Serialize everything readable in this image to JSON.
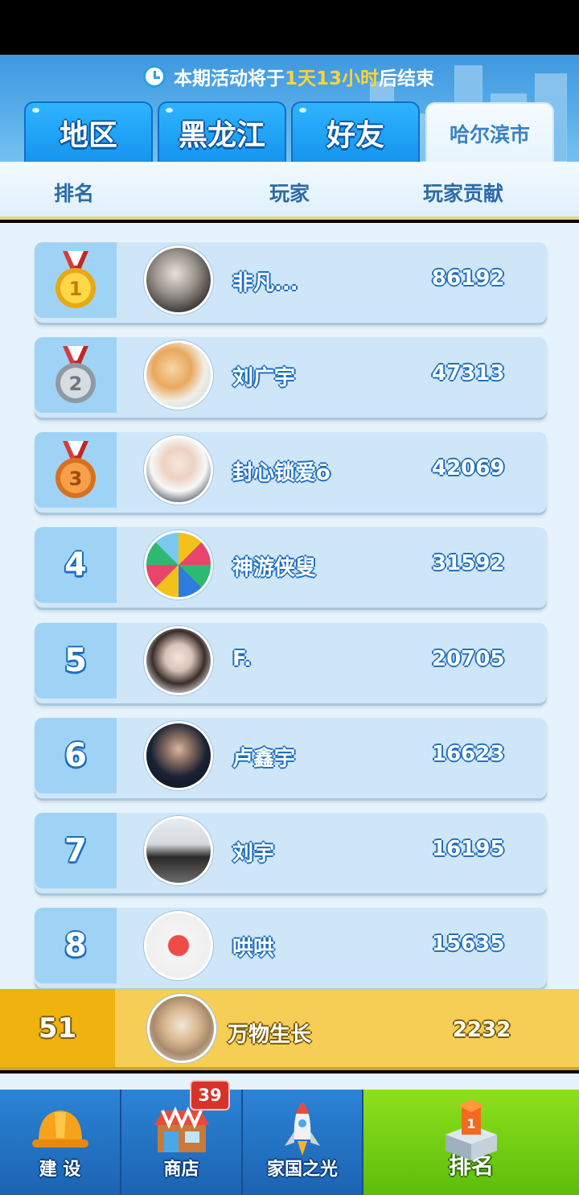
{
  "header": {
    "timer_prefix": "本期活动将于",
    "timer_value": "1天13小时",
    "timer_suffix": "后结束",
    "tabs": [
      {
        "label": "地区",
        "active": false
      },
      {
        "label": "黑龙江",
        "active": false
      },
      {
        "label": "好友",
        "active": false
      },
      {
        "label": "哈尔滨市",
        "active": true
      }
    ]
  },
  "columns": {
    "rank": "排名",
    "player": "玩家",
    "contribution": "玩家贡献"
  },
  "rows": [
    {
      "rank": "1",
      "name": "非凡...",
      "score": "86192",
      "medal": "gold"
    },
    {
      "rank": "2",
      "name": "刘广宇",
      "score": "47313",
      "medal": "silver"
    },
    {
      "rank": "3",
      "name": "封心锁爱ō",
      "score": "42069",
      "medal": "bronze"
    },
    {
      "rank": "4",
      "name": "神游侠叟",
      "score": "31592"
    },
    {
      "rank": "5",
      "name": "F.",
      "score": "20705"
    },
    {
      "rank": "6",
      "name": "卢鑫宇",
      "score": "16623"
    },
    {
      "rank": "7",
      "name": "刘宇",
      "score": "16195"
    },
    {
      "rank": "8",
      "name": "哄哄",
      "score": "15635"
    }
  ],
  "me": {
    "rank": "51",
    "name": "万物生长",
    "score": "2232"
  },
  "nav": {
    "items": [
      {
        "label": "建 设",
        "icon": "hard-hat-icon"
      },
      {
        "label": "商店",
        "icon": "shop-icon",
        "badge": "39"
      },
      {
        "label": "家国之光",
        "icon": "rocket-icon"
      },
      {
        "label": "排名",
        "icon": "podium-icon",
        "active": true
      }
    ]
  },
  "colors": {
    "accent": "#1594ee",
    "gold": "#efb20e",
    "nav_active": "#7fd616"
  }
}
